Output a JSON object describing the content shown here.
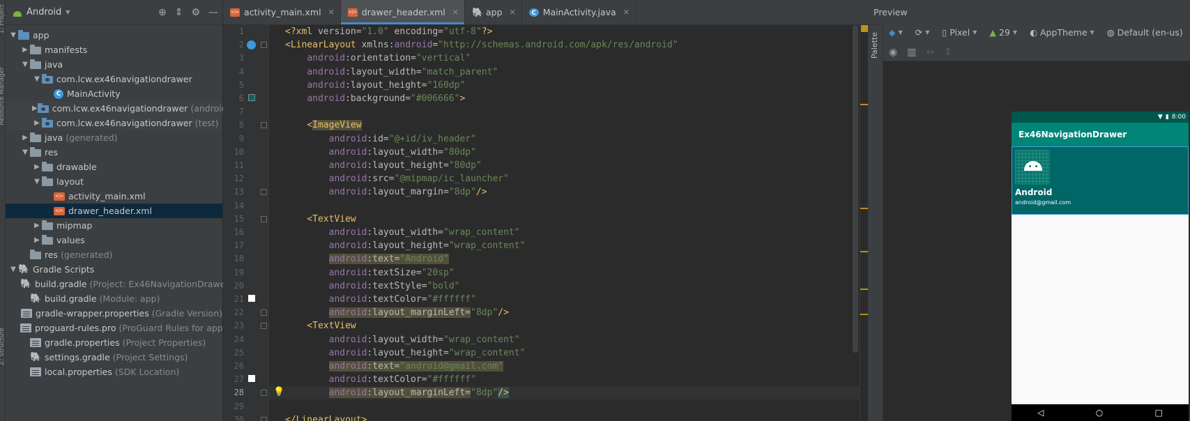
{
  "project": {
    "view": "Android",
    "side_labels": [
      "1: Project",
      "Resource Manager",
      "Z: Structure"
    ],
    "tree": [
      {
        "label": "app",
        "hint": "",
        "indent": 0,
        "arrow": "down",
        "icon": "folder-blue"
      },
      {
        "label": "manifests",
        "hint": "",
        "indent": 1,
        "arrow": "right",
        "icon": "folder"
      },
      {
        "label": "java",
        "hint": "",
        "indent": 1,
        "arrow": "down",
        "icon": "folder"
      },
      {
        "label": "com.lcw.ex46navigationdrawer",
        "hint": "",
        "indent": 2,
        "arrow": "down",
        "icon": "folder-pkg"
      },
      {
        "label": "MainActivity",
        "hint": "",
        "indent": 3,
        "arrow": "",
        "icon": "class"
      },
      {
        "label": "com.lcw.ex46navigationdrawer",
        "hint": "(androidTest)",
        "indent": 2,
        "arrow": "right",
        "icon": "folder-pkg",
        "muted": true
      },
      {
        "label": "com.lcw.ex46navigationdrawer",
        "hint": "(test)",
        "indent": 2,
        "arrow": "right",
        "icon": "folder-pkg",
        "muted": true
      },
      {
        "label": "java",
        "hint": "(generated)",
        "indent": 1,
        "arrow": "right",
        "icon": "folder"
      },
      {
        "label": "res",
        "hint": "",
        "indent": 1,
        "arrow": "down",
        "icon": "folder"
      },
      {
        "label": "drawable",
        "hint": "",
        "indent": 2,
        "arrow": "right",
        "icon": "folder"
      },
      {
        "label": "layout",
        "hint": "",
        "indent": 2,
        "arrow": "down",
        "icon": "folder"
      },
      {
        "label": "activity_main.xml",
        "hint": "",
        "indent": 3,
        "arrow": "",
        "icon": "xml"
      },
      {
        "label": "drawer_header.xml",
        "hint": "",
        "indent": 3,
        "arrow": "",
        "icon": "xml",
        "selected": true
      },
      {
        "label": "mipmap",
        "hint": "",
        "indent": 2,
        "arrow": "right",
        "icon": "folder"
      },
      {
        "label": "values",
        "hint": "",
        "indent": 2,
        "arrow": "right",
        "icon": "folder"
      },
      {
        "label": "res",
        "hint": "(generated)",
        "indent": 1,
        "arrow": "",
        "icon": "folder"
      },
      {
        "label": "Gradle Scripts",
        "hint": "",
        "indent": 0,
        "arrow": "down",
        "icon": "gradle"
      },
      {
        "label": "build.gradle",
        "hint": "(Project: Ex46NavigationDrawer)",
        "indent": 1,
        "arrow": "",
        "icon": "gradle"
      },
      {
        "label": "build.gradle",
        "hint": "(Module: app)",
        "indent": 1,
        "arrow": "",
        "icon": "gradle"
      },
      {
        "label": "gradle-wrapper.properties",
        "hint": "(Gradle Version)",
        "indent": 1,
        "arrow": "",
        "icon": "props"
      },
      {
        "label": "proguard-rules.pro",
        "hint": "(ProGuard Rules for app)",
        "indent": 1,
        "arrow": "",
        "icon": "props"
      },
      {
        "label": "gradle.properties",
        "hint": "(Project Properties)",
        "indent": 1,
        "arrow": "",
        "icon": "props"
      },
      {
        "label": "settings.gradle",
        "hint": "(Project Settings)",
        "indent": 1,
        "arrow": "",
        "icon": "gradle"
      },
      {
        "label": "local.properties",
        "hint": "(SDK Location)",
        "indent": 1,
        "arrow": "",
        "icon": "props"
      }
    ]
  },
  "tabs": [
    {
      "label": "activity_main.xml",
      "icon": "xml",
      "active": false
    },
    {
      "label": "drawer_header.xml",
      "icon": "xml",
      "active": true
    },
    {
      "label": "app",
      "icon": "gradle",
      "active": false
    },
    {
      "label": "MainActivity.java",
      "icon": "class",
      "active": false
    }
  ],
  "editor": {
    "current_line": 28,
    "lines": [
      [
        [
          "pi",
          "<?"
        ],
        [
          "t-tag",
          "xml "
        ],
        [
          "t-attr",
          "version="
        ],
        [
          "t-val",
          "\"1.0\""
        ],
        [
          "t-attr",
          " encoding="
        ],
        [
          "t-val",
          "\"utf-8\""
        ],
        [
          "pi",
          "?>"
        ]
      ],
      [
        [
          "t-bracket",
          "<"
        ],
        [
          "t-tag",
          "LinearLayout "
        ],
        [
          "t-attr",
          "xmlns:"
        ],
        [
          "t-ns",
          "android"
        ],
        [
          "t-attr",
          "="
        ],
        [
          "t-val",
          "\"http://schemas.android.com/apk/res/android\""
        ]
      ],
      [
        [
          "t-plain",
          "    "
        ],
        [
          "t-ns",
          "android"
        ],
        [
          "t-attr",
          ":orientation="
        ],
        [
          "t-val",
          "\"vertical\""
        ]
      ],
      [
        [
          "t-plain",
          "    "
        ],
        [
          "t-ns",
          "android"
        ],
        [
          "t-attr",
          ":layout_width="
        ],
        [
          "t-val",
          "\"match_parent\""
        ]
      ],
      [
        [
          "t-plain",
          "    "
        ],
        [
          "t-ns",
          "android"
        ],
        [
          "t-attr",
          ":layout_height="
        ],
        [
          "t-val",
          "\"160dp\""
        ]
      ],
      [
        [
          "t-plain",
          "    "
        ],
        [
          "t-ns",
          "android"
        ],
        [
          "t-attr",
          ":background="
        ],
        [
          "t-val",
          "\"#006666\""
        ],
        [
          "t-bracket",
          ">"
        ]
      ],
      [],
      [
        [
          "t-plain",
          "    "
        ],
        [
          "t-bracket",
          "<"
        ],
        [
          "t-tag hl-warn",
          "ImageView"
        ]
      ],
      [
        [
          "t-plain",
          "        "
        ],
        [
          "t-ns",
          "android"
        ],
        [
          "t-attr",
          ":id="
        ],
        [
          "t-val",
          "\"@+id/iv_header\""
        ]
      ],
      [
        [
          "t-plain",
          "        "
        ],
        [
          "t-ns",
          "android"
        ],
        [
          "t-attr",
          ":layout_width="
        ],
        [
          "t-val",
          "\"80dp\""
        ]
      ],
      [
        [
          "t-plain",
          "        "
        ],
        [
          "t-ns",
          "android"
        ],
        [
          "t-attr",
          ":layout_height="
        ],
        [
          "t-val",
          "\"80dp\""
        ]
      ],
      [
        [
          "t-plain",
          "        "
        ],
        [
          "t-ns",
          "android"
        ],
        [
          "t-attr",
          ":src="
        ],
        [
          "t-val",
          "\"@mipmap/ic_launcher\""
        ]
      ],
      [
        [
          "t-plain",
          "        "
        ],
        [
          "t-ns",
          "android"
        ],
        [
          "t-attr",
          ":layout_margin="
        ],
        [
          "t-val",
          "\"8dp\""
        ],
        [
          "t-bracket",
          "/>"
        ]
      ],
      [],
      [
        [
          "t-plain",
          "    "
        ],
        [
          "t-bracket",
          "<"
        ],
        [
          "t-tag",
          "TextView"
        ]
      ],
      [
        [
          "t-plain",
          "        "
        ],
        [
          "t-ns",
          "android"
        ],
        [
          "t-attr",
          ":layout_width="
        ],
        [
          "t-val",
          "\"wrap_content\""
        ]
      ],
      [
        [
          "t-plain",
          "        "
        ],
        [
          "t-ns",
          "android"
        ],
        [
          "t-attr",
          ":layout_height="
        ],
        [
          "t-val",
          "\"wrap_content\""
        ]
      ],
      [
        [
          "t-plain",
          "        "
        ],
        [
          "t-ns hl-warn",
          "android"
        ],
        [
          "t-attr hl-warn",
          ":text="
        ],
        [
          "t-val hl-warn",
          "\"Android\""
        ]
      ],
      [
        [
          "t-plain",
          "        "
        ],
        [
          "t-ns",
          "android"
        ],
        [
          "t-attr",
          ":textSize="
        ],
        [
          "t-val",
          "\"20sp\""
        ]
      ],
      [
        [
          "t-plain",
          "        "
        ],
        [
          "t-ns",
          "android"
        ],
        [
          "t-attr",
          ":textStyle="
        ],
        [
          "t-val",
          "\"bold\""
        ]
      ],
      [
        [
          "t-plain",
          "        "
        ],
        [
          "t-ns",
          "android"
        ],
        [
          "t-attr",
          ":textColor="
        ],
        [
          "t-val",
          "\"#ffffff\""
        ]
      ],
      [
        [
          "t-plain",
          "        "
        ],
        [
          "t-ns hl-warn",
          "android"
        ],
        [
          "t-attr hl-warn",
          ":layout_marginLeft="
        ],
        [
          "t-val",
          "\"8dp\""
        ],
        [
          "t-bracket",
          "/>"
        ]
      ],
      [
        [
          "t-plain",
          "    "
        ],
        [
          "t-bracket",
          "<"
        ],
        [
          "t-tag",
          "TextView"
        ]
      ],
      [
        [
          "t-plain",
          "        "
        ],
        [
          "t-ns",
          "android"
        ],
        [
          "t-attr",
          ":layout_width="
        ],
        [
          "t-val",
          "\"wrap_content\""
        ]
      ],
      [
        [
          "t-plain",
          "        "
        ],
        [
          "t-ns",
          "android"
        ],
        [
          "t-attr",
          ":layout_height="
        ],
        [
          "t-val",
          "\"wrap_content\""
        ]
      ],
      [
        [
          "t-plain",
          "        "
        ],
        [
          "t-ns hl-warn",
          "android"
        ],
        [
          "t-attr hl-warn",
          ":text="
        ],
        [
          "t-val hl-warn",
          "\"android@gmail.com\""
        ]
      ],
      [
        [
          "t-plain",
          "        "
        ],
        [
          "t-ns",
          "android"
        ],
        [
          "t-attr",
          ":textColor="
        ],
        [
          "t-val",
          "\"#ffffff\""
        ]
      ],
      [
        [
          "t-plain",
          "        "
        ],
        [
          "t-ns hl-warn",
          "android"
        ],
        [
          "t-attr hl-warn",
          ":layout_marginLeft="
        ],
        [
          "t-val",
          "\"8dp\""
        ],
        [
          "t-bracket hl-tag",
          "/>"
        ]
      ],
      [],
      [
        [
          "t-bracket",
          "</"
        ],
        [
          "t-tag",
          "LinearLayout"
        ],
        [
          "t-bracket",
          ">"
        ]
      ]
    ]
  },
  "preview": {
    "title": "Preview",
    "palette_label": "Palette",
    "toolbar": {
      "device": "Pixel",
      "api": "29",
      "theme": "AppTheme",
      "locale": "Default (en-us)"
    },
    "status_time": "8:00",
    "app_title": "Ex46NavigationDrawer",
    "header_name": "Android",
    "header_email": "android@gmail.com",
    "colors": {
      "status_bar": "#00574b",
      "app_bar": "#008577",
      "header_bg": "#006666"
    }
  }
}
